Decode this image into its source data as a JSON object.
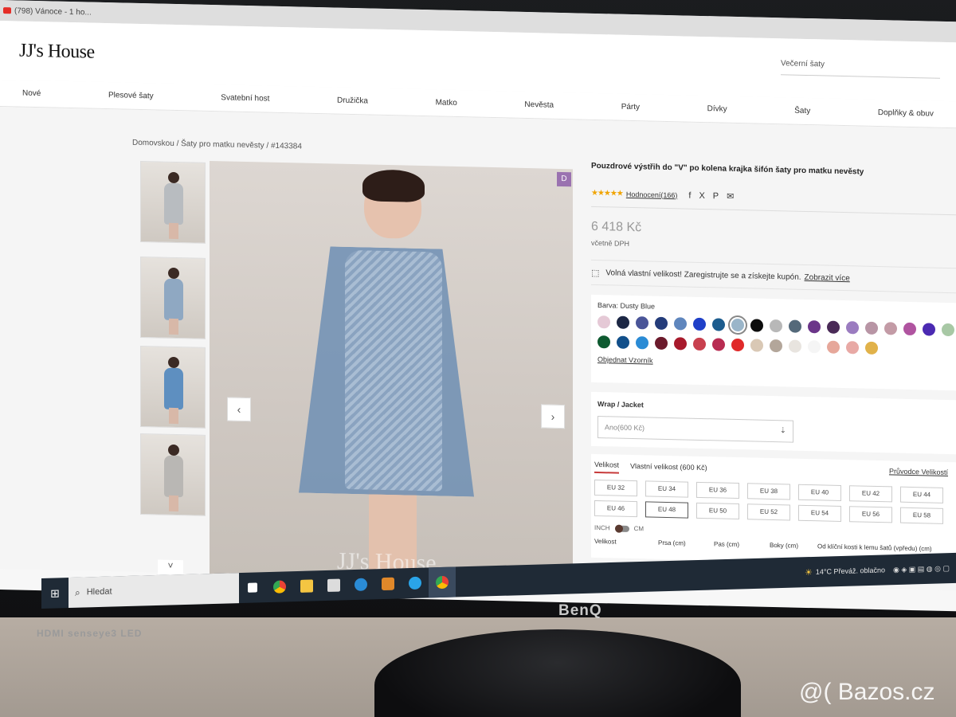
{
  "browser": {
    "tab_title": "(798) Vánoce - 1 ho..."
  },
  "site": {
    "logo": "JJ's House",
    "search_placeholder": "Večerní šaty",
    "nav": [
      "Nové",
      "Plesové šaty",
      "Svatební host",
      "Družička",
      "Matko",
      "Nevěsta",
      "Párty",
      "Dívky",
      "Šaty",
      "Doplňky & obuv"
    ]
  },
  "breadcrumb": "Domovskou / Šaty pro matku nevěsty / #143384",
  "gallery": {
    "thumb_colors": [
      "#b8bcc0",
      "#8fa8c2",
      "#5e8fc0",
      "#b9b7b4"
    ],
    "badge": "D",
    "watermark": "JJ's House"
  },
  "product": {
    "title": "Pouzdrové výstřih do \"V\" po kolena krajka šifón šaty pro matku nevěsty",
    "stars": "★★★★★",
    "reviews": "Hodnocení(166)",
    "share_icons": [
      "f",
      "X",
      "P",
      "✉"
    ],
    "price": "6 418 Kč",
    "vat_note": "včetně DPH",
    "promo_text": "Volná vlastní velikost! Zaregistrujte se a získejte kupón.",
    "promo_link": "Zobrazit více",
    "color_label": "Barva: Dusty Blue",
    "color_swatches": [
      "#e5c9d6",
      "#1c2744",
      "#4a5598",
      "#243c7a",
      "#5f86bd",
      "#1f40c8",
      "#1c5c8e",
      "#9ab5c9",
      "#0d0d0d",
      "#b8b8b8",
      "#54697a",
      "#6b3589",
      "#4a2a57",
      "#9b7cc0",
      "#b895a5",
      "#c39ba6",
      "#b054a0",
      "#4b2ab2",
      "#a8c8a5",
      "#0e5a30",
      "#114f8a",
      "#2a8bd5",
      "#6b1a2c",
      "#a81a2c",
      "#c8404e",
      "#b82c52",
      "#e02a2a",
      "#d9c8b5",
      "#b3a69a",
      "#e8e4df",
      "#f5f5f5",
      "#e6a79a",
      "#e8a9a5",
      "#e1b24a"
    ],
    "selected_swatch_index": 7,
    "order_samples": "Objednat Vzorník",
    "wrap_label": "Wrap / Jacket",
    "wrap_value": "Ano(600 Kč)",
    "size_tabs": [
      "Velikost",
      "Vlastní velikost (600 Kč)"
    ],
    "size_guide": "Průvodce Velikostí",
    "sizes": [
      "EU 32",
      "EU 34",
      "EU 36",
      "EU 38",
      "EU 40",
      "EU 42",
      "EU 44",
      "EU 46",
      "EU 48",
      "EU 50",
      "EU 52",
      "EU 54",
      "EU 56",
      "EU 58"
    ],
    "selected_size_index": 8,
    "unit_inch": "INCH",
    "unit_cm": "CM",
    "size_table_headers": [
      "Velikost",
      "Prsa (cm)",
      "Pas (cm)",
      "Boky (cm)",
      "Od klíční kosti k lemu šatů (vpředu) (cm)"
    ]
  },
  "taskbar": {
    "search": "Hledat",
    "weather": "14°C Převáž. oblačno"
  },
  "monitor": {
    "brand": "BenQ",
    "left_label": "HDMI senseye3 LED"
  },
  "watermark_site": "@( Bazos.cz"
}
